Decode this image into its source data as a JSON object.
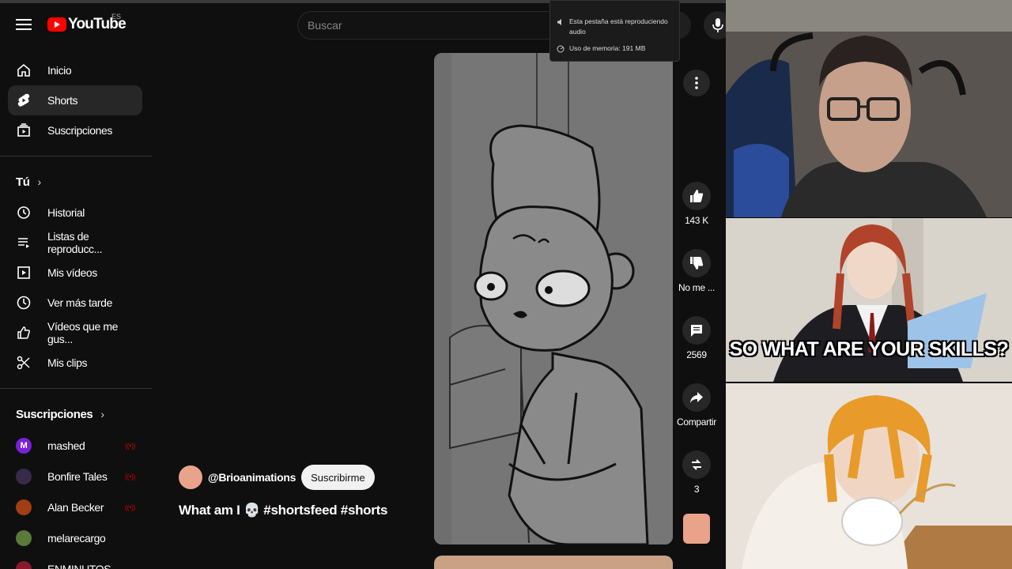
{
  "app": {
    "brand": "YouTube",
    "country": "ES"
  },
  "search": {
    "placeholder": "Buscar"
  },
  "tooltip": {
    "audio_text": "Esta pestaña está reproduciendo audio",
    "memory_text": "Uso de memoria: 191 MB"
  },
  "sidebar": {
    "main": [
      {
        "label": "Inicio",
        "icon": "home-icon"
      },
      {
        "label": "Shorts",
        "icon": "shorts-icon",
        "active": true
      },
      {
        "label": "Suscripciones",
        "icon": "subscriptions-icon"
      }
    ],
    "you_title": "Tú",
    "you": [
      {
        "label": "Historial",
        "icon": "history-icon"
      },
      {
        "label": "Listas de reproducc...",
        "icon": "playlist-icon"
      },
      {
        "label": "Mis vídeos",
        "icon": "my-videos-icon"
      },
      {
        "label": "Ver más tarde",
        "icon": "clock-icon"
      },
      {
        "label": "Vídeos que me gus...",
        "icon": "like-icon"
      },
      {
        "label": "Mis clips",
        "icon": "scissors-icon"
      }
    ],
    "subs_title": "Suscripciones",
    "subs": [
      {
        "label": "mashed",
        "avatar_letter": "M",
        "color": "#7b1fd9",
        "live": true
      },
      {
        "label": "Bonfire Tales",
        "avatar_letter": "",
        "color": "#3a2a4a",
        "live": true
      },
      {
        "label": "Alan Becker",
        "avatar_letter": "",
        "color": "#a33d12",
        "live": true
      },
      {
        "label": "melarecargo",
        "avatar_letter": "",
        "color": "#5a7a3a",
        "live": false
      },
      {
        "label": "ENMINUTOS",
        "avatar_letter": "",
        "color": "#8a1a2a",
        "live": false
      }
    ]
  },
  "short": {
    "channel": "@Brioanimations",
    "subscribe_label": "Suscribirme",
    "title": "What am I 💀 #shortsfeed #shorts",
    "likes": "143 K",
    "dislike_label": "No me ...",
    "comments": "2569",
    "share_label": "Compartir",
    "remix_count": "3"
  },
  "meme": {
    "caption": "SO WHAT ARE YOUR SKILLS?"
  }
}
